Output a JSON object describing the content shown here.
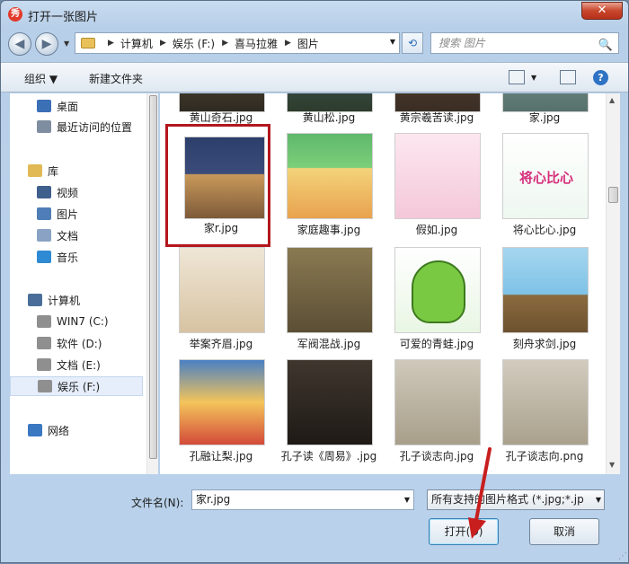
{
  "window": {
    "title": "打开一张图片",
    "app_icon_glyph": "秀",
    "close_glyph": "✕"
  },
  "nav": {
    "back_glyph": "◀",
    "forward_glyph": "▶",
    "dropdown_glyph": "▼",
    "refresh_glyph": "⟲"
  },
  "address": {
    "crumbs": [
      "计算机",
      "娱乐 (F:)",
      "喜马拉雅",
      "图片"
    ],
    "sep": "▶",
    "dropdown_glyph": "▼"
  },
  "search": {
    "placeholder": "搜索 图片",
    "icon": "🔍"
  },
  "toolbar": {
    "organize": "组织 ▼",
    "new_folder": "新建文件夹",
    "view_glyph": "▼",
    "help": "?"
  },
  "sidebar": {
    "items": [
      {
        "label": "桌面",
        "icon": "desktop-icon"
      },
      {
        "label": "最近访问的位置",
        "icon": "recent-places-icon"
      },
      {
        "label": "库",
        "icon": "library-icon"
      },
      {
        "label": "视频",
        "icon": "video-icon"
      },
      {
        "label": "图片",
        "icon": "pictures-icon"
      },
      {
        "label": "文档",
        "icon": "documents-icon"
      },
      {
        "label": "音乐",
        "icon": "music-icon"
      },
      {
        "label": "计算机",
        "icon": "computer-icon"
      },
      {
        "label": "WIN7 (C:)",
        "icon": "drive-icon"
      },
      {
        "label": "软件 (D:)",
        "icon": "drive-icon"
      },
      {
        "label": "文档 (E:)",
        "icon": "drive-icon"
      },
      {
        "label": "娱乐 (F:)",
        "icon": "drive-icon"
      },
      {
        "label": "网络",
        "icon": "network-icon"
      }
    ]
  },
  "files": [
    "黄山奇石.jpg",
    "黄山松.jpg",
    "黄宗羲苦读.jpg",
    "家.jpg",
    "家r.jpg",
    "家庭趣事.jpg",
    "假如.jpg",
    "将心比心.jpg",
    "举案齐眉.jpg",
    "军阀混战.jpg",
    "可爱的青蛙.jpg",
    "刻舟求剑.jpg",
    "孔融让梨.jpg",
    "孔子读《周易》.jpg",
    "孔子谈志向.jpg",
    "孔子谈志向.png"
  ],
  "thumb_texts": {
    "heart_title": "将心比心"
  },
  "selected_file_index": 4,
  "bottom": {
    "filename_label": "文件名(N):",
    "filename_value": "家r.jpg",
    "filter_value": "所有支持的图片格式 (*.jpg;*.jp",
    "open_label": "打开(O)",
    "cancel_label": "取消",
    "dropdown_glyph": "▼",
    "grip": "⋰"
  },
  "colors": {
    "selection_frame": "#b3171d",
    "annotation_arrow": "#c81e1e"
  }
}
